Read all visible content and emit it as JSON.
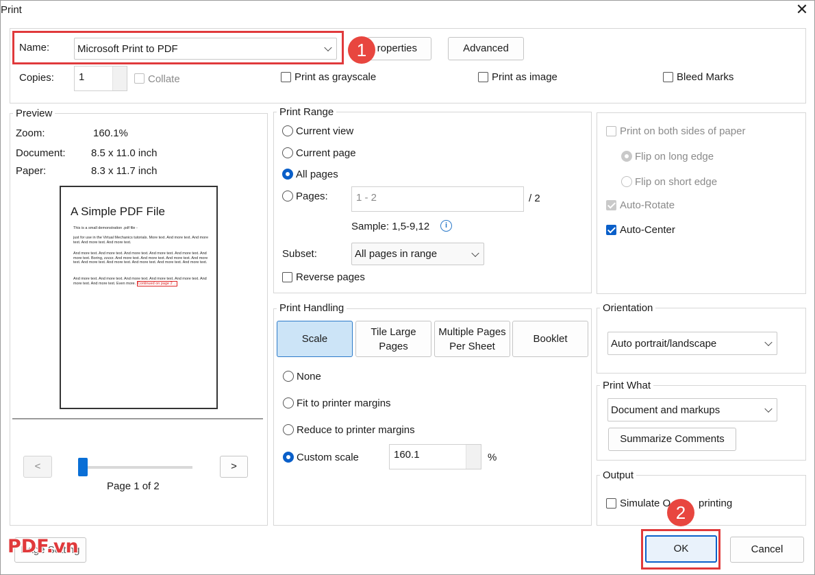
{
  "window": {
    "title": "Print",
    "close_glyph": "✕"
  },
  "printer": {
    "name_label": "Name:",
    "name_value": "Microsoft Print to PDF",
    "properties_label": "Properties",
    "properties_visible": "roperties",
    "advanced_label": "Advanced",
    "copies_label": "Copies:",
    "copies_value": "1",
    "collate_label": "Collate",
    "grayscale_label": "Print as grayscale",
    "image_label": "Print as image",
    "bleed_label": "Bleed Marks"
  },
  "preview": {
    "group_label": "Preview",
    "zoom_label": "Zoom:",
    "zoom_value": "160.1%",
    "document_label": "Document:",
    "document_value": "8.5 x 11.0 inch",
    "paper_label": "Paper:",
    "paper_value": "8.3 x 11.7 inch",
    "page_title": "A Simple PDF File",
    "page_lines": [
      "This is a small demonstration .pdf file -",
      "just for use in the Virtual Mechanics tutorials. More text. And more text. And more text. And more text. And more text.",
      "And more text. And more text. And more text. And more text. And more text. And more text. Boring, zzzzz. And more text. And more text. And more text. And more text. And more text. And more text. And more text. And more text. And more text.",
      "And more text. And more text. And more text. And more text. And more text. And more text. And more text. Even more."
    ],
    "page_continued": "Continued on page 2 ...",
    "prev_label": "<",
    "next_label": ">",
    "page_indicator": "Page 1 of 2",
    "slider_position": 0
  },
  "print_range": {
    "group_label": "Print Range",
    "current_view": "Current view",
    "current_page": "Current page",
    "all_pages": "All pages",
    "pages_label": "Pages:",
    "pages_placeholder": "1 - 2",
    "pages_total": "/ 2",
    "sample": "Sample: 1,5-9,12",
    "info_glyph": "i",
    "subset_label": "Subset:",
    "subset_value": "All pages in range",
    "reverse_label": "Reverse pages"
  },
  "duplex": {
    "both_sides": "Print on both sides of paper",
    "flip_long": "Flip on long edge",
    "flip_short": "Flip on short edge",
    "auto_rotate": "Auto-Rotate",
    "auto_center": "Auto-Center"
  },
  "handling": {
    "group_label": "Print Handling",
    "tab_scale": "Scale",
    "tab_tile_1": "Tile Large",
    "tab_tile_2": "Pages",
    "tab_multi_1": "Multiple Pages",
    "tab_multi_2": "Per Sheet",
    "tab_booklet": "Booklet",
    "none": "None",
    "fit": "Fit to printer margins",
    "reduce": "Reduce to printer margins",
    "custom": "Custom scale",
    "custom_value": "160.1",
    "percent": "%"
  },
  "orientation": {
    "group_label": "Orientation",
    "value": "Auto portrait/landscape"
  },
  "print_what": {
    "group_label": "Print What",
    "value": "Document and markups",
    "summarize": "Summarize Comments"
  },
  "output": {
    "group_label": "Output",
    "simulate_visible": "Simulate O",
    "simulate_tail": "printing"
  },
  "footer": {
    "page_setup": "Page Setting",
    "ok": "OK",
    "cancel": "Cancel"
  },
  "annotations": {
    "badge_1": "1",
    "badge_2": "2",
    "watermark": "PDF.vn"
  },
  "colors": {
    "accent": "#0a5fc9",
    "annotation_red": "#e0393b",
    "active_tab": "#cce4f7"
  }
}
